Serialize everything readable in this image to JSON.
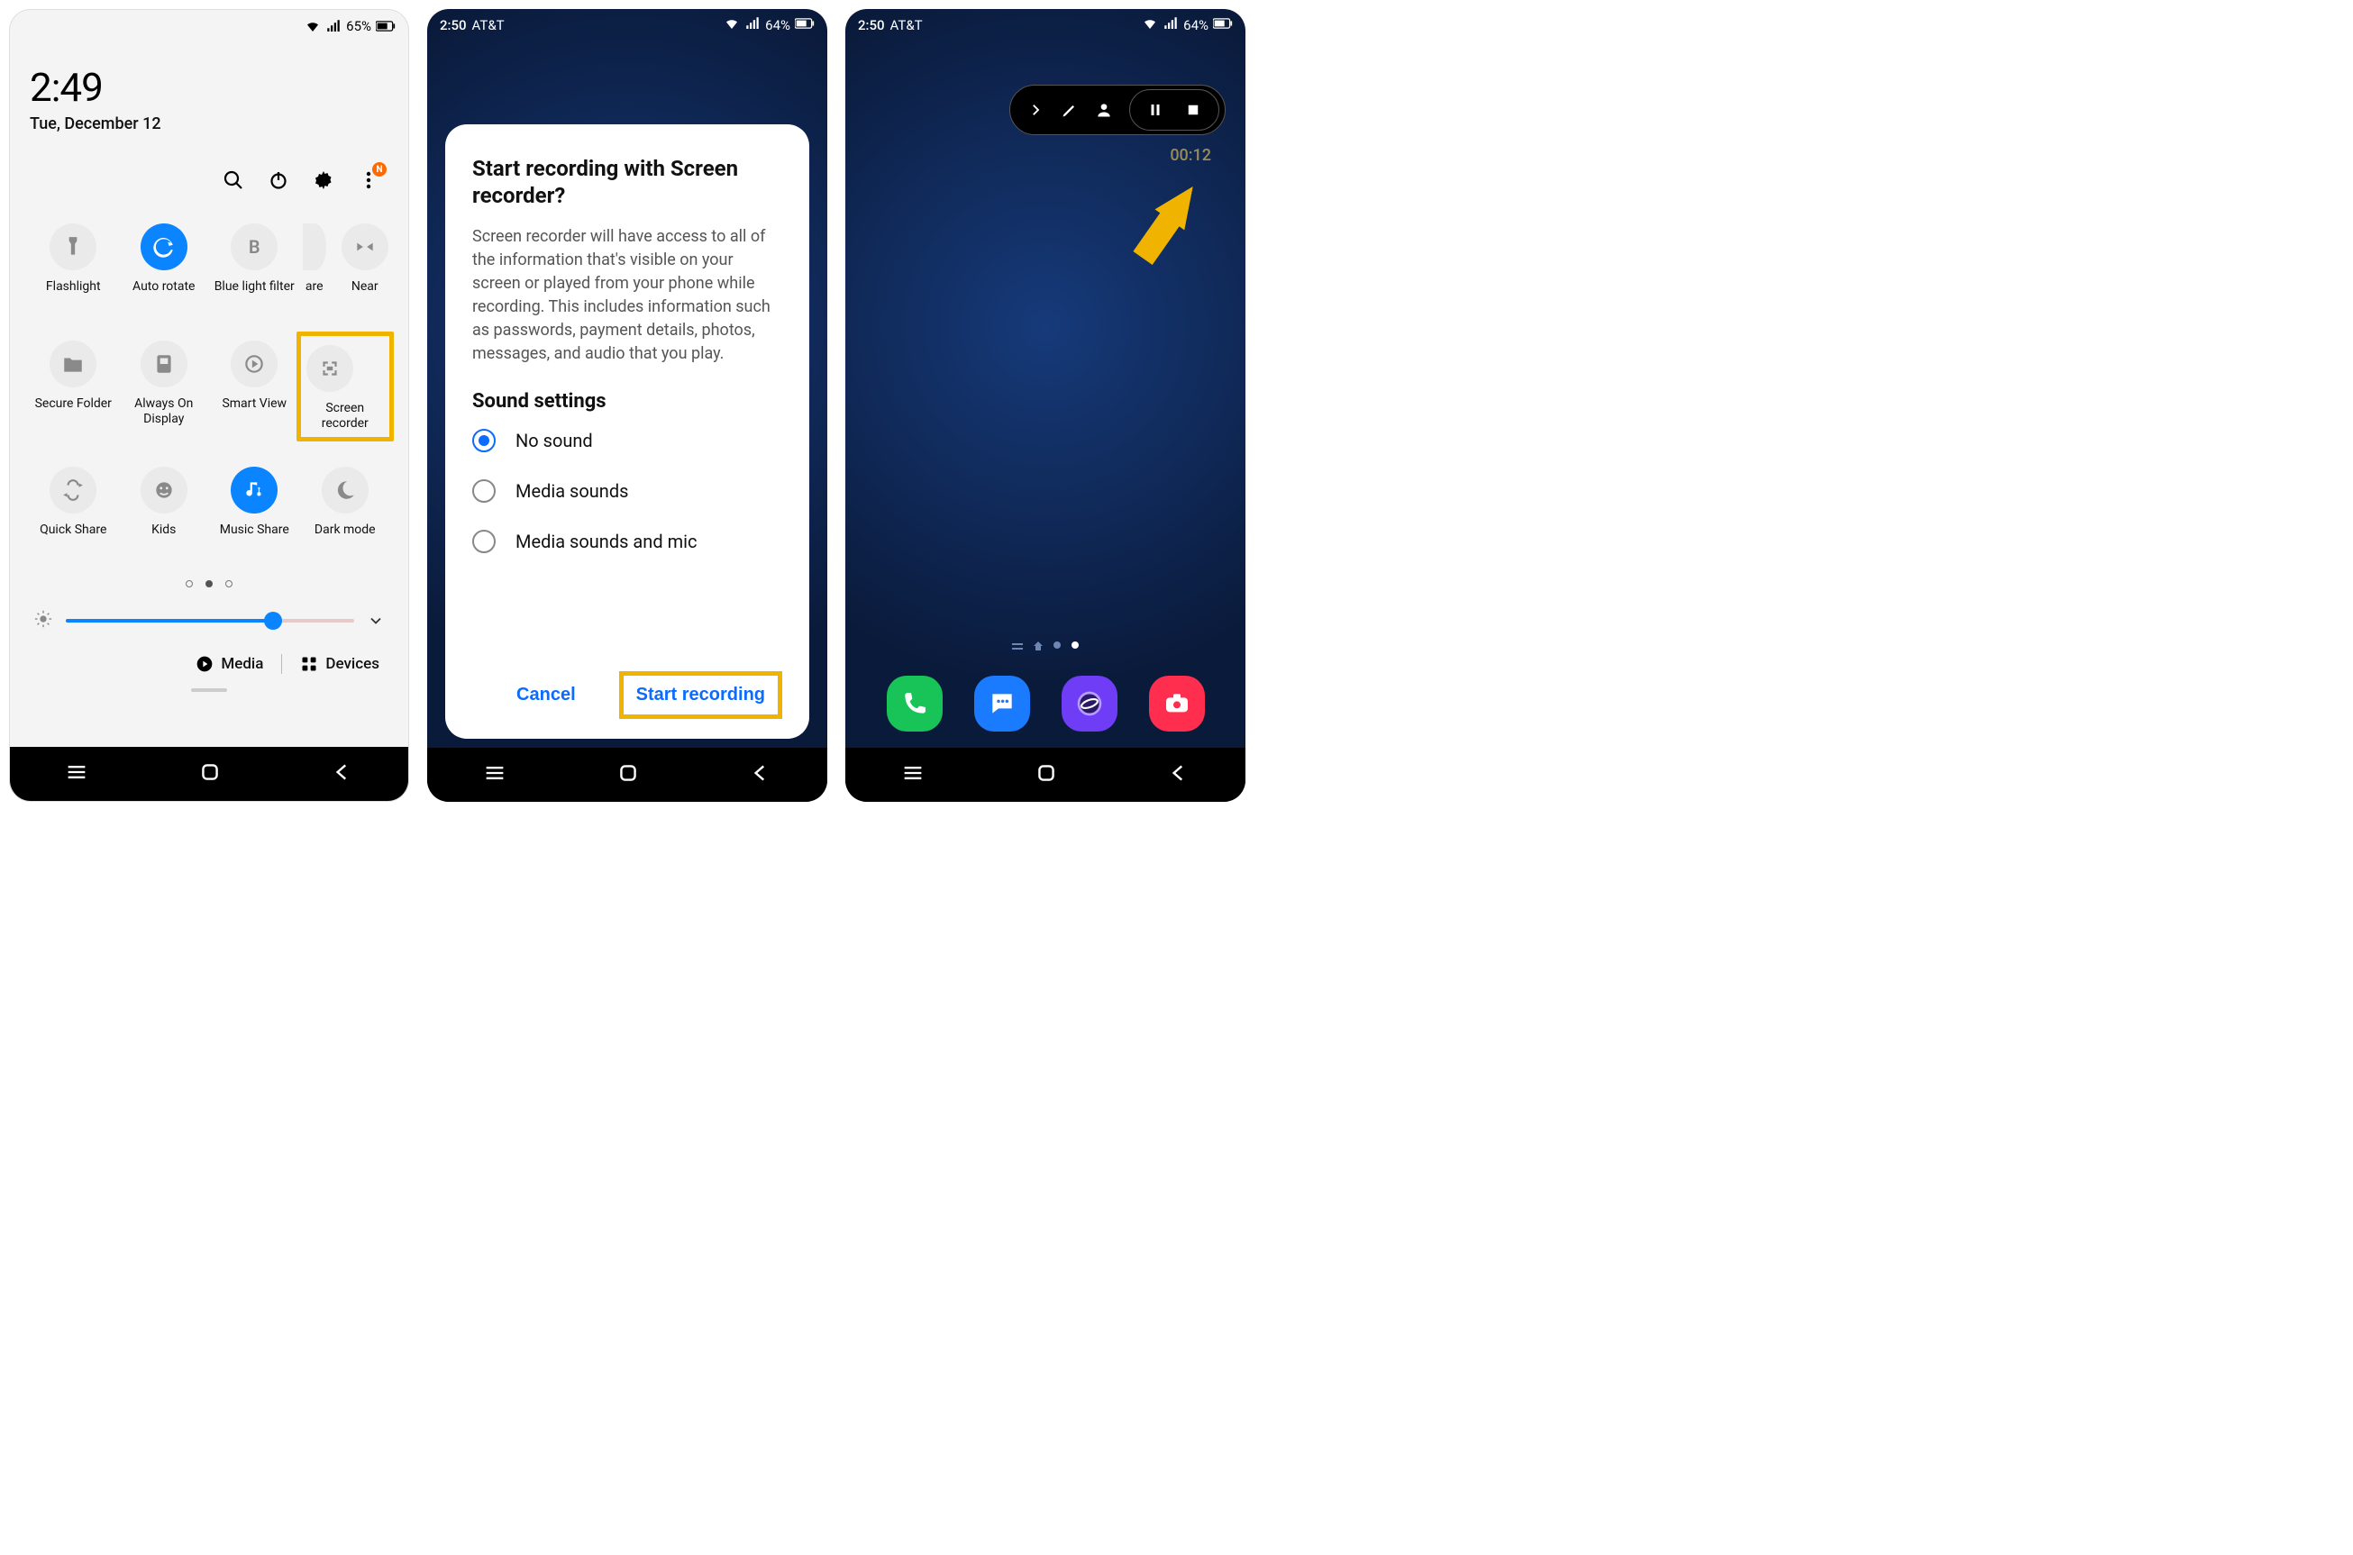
{
  "phone1": {
    "status": {
      "battery_text": "65%"
    },
    "clock": "2:49",
    "date": "Tue, December 12",
    "actions": {
      "notif_badge": "N"
    },
    "tiles": [
      {
        "id": "flashlight",
        "label": "Flashlight",
        "active": false
      },
      {
        "id": "auto-rotate",
        "label": "Auto rotate",
        "active": true
      },
      {
        "id": "blue-light",
        "label": "Blue light filter",
        "active": false
      },
      {
        "id": "share-cut",
        "label": "are",
        "active": false,
        "cut": true
      },
      {
        "id": "nearby-cut",
        "label": "Near",
        "active": false,
        "cut": true
      },
      {
        "id": "secure",
        "label": "Secure Folder",
        "active": false
      },
      {
        "id": "aod",
        "label": "Always On Display",
        "active": false
      },
      {
        "id": "smartview",
        "label": "Smart View",
        "active": false
      },
      {
        "id": "screenrec",
        "label": "Screen recorder",
        "active": false,
        "highlight": true
      },
      {
        "id": "quickshare",
        "label": "Quick Share",
        "active": false
      },
      {
        "id": "kids",
        "label": "Kids",
        "active": false
      },
      {
        "id": "musicshare",
        "label": "Music Share",
        "active": true
      },
      {
        "id": "darkmode",
        "label": "Dark mode",
        "active": false
      }
    ],
    "brightness_percent": 72,
    "media_label": "Media",
    "devices_label": "Devices"
  },
  "phone2": {
    "status": {
      "time": "2:50",
      "carrier": "AT&T",
      "battery_text": "64%"
    },
    "dialog": {
      "title": "Start recording with Screen recorder?",
      "body": "Screen recorder will have access to all of the information that's visible on your screen or played from your phone while recording. This includes information such as passwords, payment details, photos, messages, and audio that you play.",
      "sound_heading": "Sound settings",
      "options": [
        {
          "label": "No sound",
          "selected": true
        },
        {
          "label": "Media sounds",
          "selected": false
        },
        {
          "label": "Media sounds and mic",
          "selected": false
        }
      ],
      "cancel": "Cancel",
      "start": "Start recording"
    }
  },
  "phone3": {
    "status": {
      "time": "2:50",
      "carrier": "AT&T",
      "battery_text": "64%"
    },
    "rec_timer": "00:12",
    "dock": [
      {
        "id": "phone",
        "name": "Phone",
        "color": "#18c458"
      },
      {
        "id": "messages",
        "name": "Messages",
        "color": "#1a7bff"
      },
      {
        "id": "browser",
        "name": "Internet",
        "color": "#6e3df5"
      },
      {
        "id": "camera",
        "name": "Camera",
        "color": "#ff2d4e"
      }
    ]
  }
}
